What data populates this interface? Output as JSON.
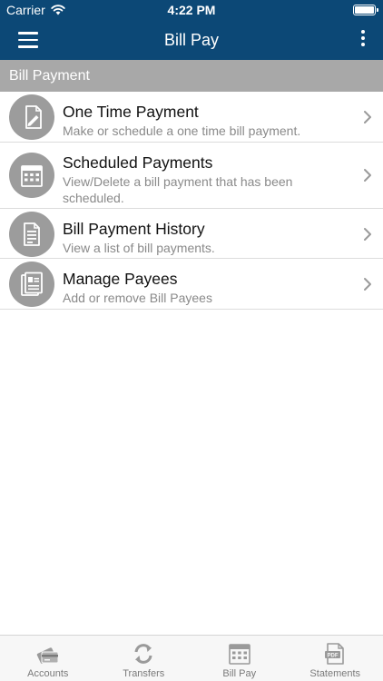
{
  "status_bar": {
    "carrier": "Carrier",
    "time": "4:22 PM",
    "icons": [
      "wifi-icon",
      "battery-icon"
    ]
  },
  "header": {
    "title": "Bill Pay",
    "menu_icon": "hamburger-menu-icon",
    "more_icon": "more-vertical-icon"
  },
  "section": {
    "title": "Bill Payment"
  },
  "items": [
    {
      "title": "One Time Payment",
      "subtitle": "Make or schedule a one time bill payment.",
      "icon": "edit-document-icon"
    },
    {
      "title": "Scheduled Payments",
      "subtitle": "View/Delete a bill payment that has been scheduled.",
      "icon": "calendar-icon"
    },
    {
      "title": "Bill Payment History",
      "subtitle": "View a list of bill payments.",
      "icon": "document-list-icon"
    },
    {
      "title": "Manage Payees",
      "subtitle": "Add or remove Bill Payees",
      "icon": "payee-card-icon"
    }
  ],
  "tabs": [
    {
      "label": "Accounts",
      "icon": "cards-icon"
    },
    {
      "label": "Transfers",
      "icon": "transfer-arrows-icon"
    },
    {
      "label": "Bill Pay",
      "icon": "calendar-icon"
    },
    {
      "label": "Statements",
      "icon": "pdf-document-icon"
    }
  ],
  "colors": {
    "header": "#0c4876",
    "section_header": "#a8a8a8",
    "icon_circle": "#9c9c9c",
    "subtitle": "#8a8a8a",
    "tab_label": "#7a7a7a"
  }
}
